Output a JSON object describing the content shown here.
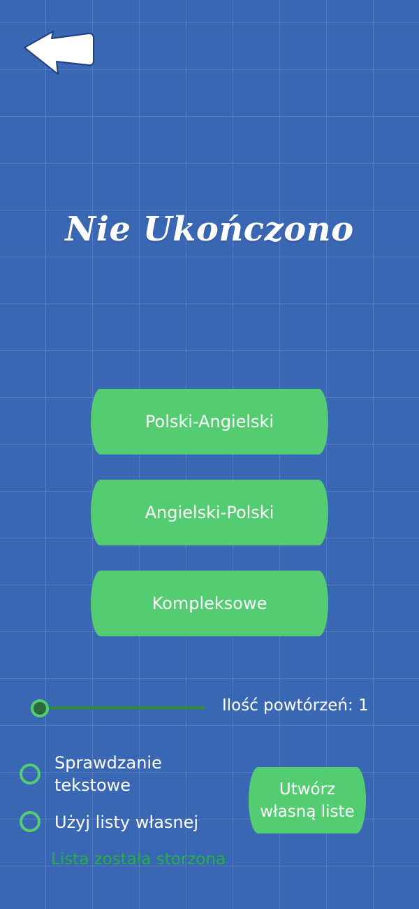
{
  "header": {
    "back_icon": "back-arrow-icon"
  },
  "title": "Nie Ukończono",
  "modes": [
    {
      "label": "Polski-Angielski"
    },
    {
      "label": "Angielski-Polski"
    },
    {
      "label": "Kompleksowe"
    }
  ],
  "repetitions": {
    "label": "Ilość powtórzeń: 1",
    "value": 1,
    "slider_fraction": 0
  },
  "options": {
    "text_check": {
      "line1": "Sprawdzanie",
      "line2": "tekstowe",
      "checked": false
    },
    "own_list": {
      "label": "Użyj listy własnej",
      "checked": false
    }
  },
  "create_button": {
    "line1": "Utwórz",
    "line2": "własną liste"
  },
  "status": "Lista została storzona",
  "colors": {
    "background": "#3a67b4",
    "accent": "#53cc72",
    "status": "#24b043",
    "text": "#ffffff"
  }
}
